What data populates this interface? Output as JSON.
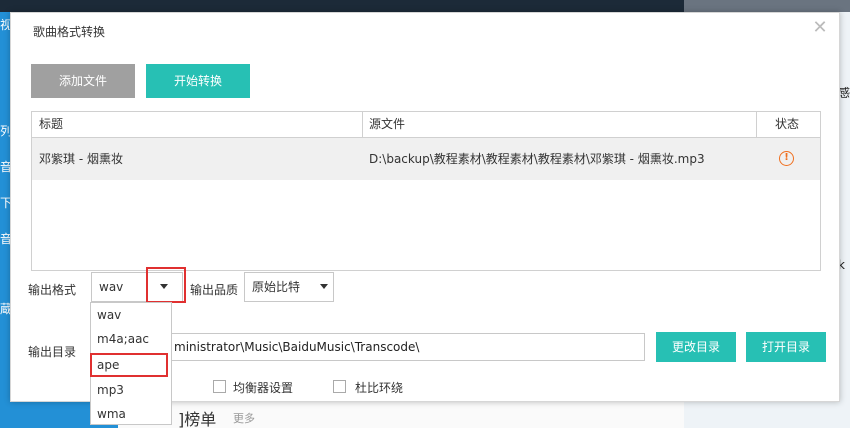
{
  "background": {
    "left_chars": [
      "视",
      "列",
      "音",
      "下",
      "音",
      "蔵"
    ],
    "right_chars": [
      "感",
      "k"
    ],
    "rank_label": "]榜单",
    "more_label": "更多"
  },
  "dialog": {
    "title": "歌曲格式转换",
    "close_glyph": "✕"
  },
  "toolbar": {
    "add_file_label": "添加文件",
    "start_convert_label": "开始转换"
  },
  "table": {
    "headers": [
      "标题",
      "源文件",
      "状态"
    ],
    "rows": [
      {
        "title": "邓紫琪 - 烟熏妆",
        "source": "D:\\backup\\教程素材\\教程素材\\教程素材\\邓紫琪 - 烟熏妆.mp3",
        "status_icon": "warning-icon",
        "status_glyph": "!"
      }
    ]
  },
  "output": {
    "format_label": "输出格式",
    "format_value": "wav",
    "quality_label": "输出品质",
    "quality_value": "原始比特",
    "format_options": [
      "wav",
      "m4a;aac",
      "ape",
      "mp3",
      "wma"
    ],
    "highlighted_option": "ape",
    "directory_label": "输出目录",
    "directory_value": "ministrator\\Music\\BaiduMusic\\Transcode\\",
    "change_dir_label": "更改目录",
    "open_dir_label": "打开目录",
    "equalizer_label": "均衡器设置",
    "dolby_label": "杜比环绕"
  },
  "colors": {
    "accent": "#27c0b4",
    "highlight": "#e03030",
    "warning": "#f07020"
  }
}
